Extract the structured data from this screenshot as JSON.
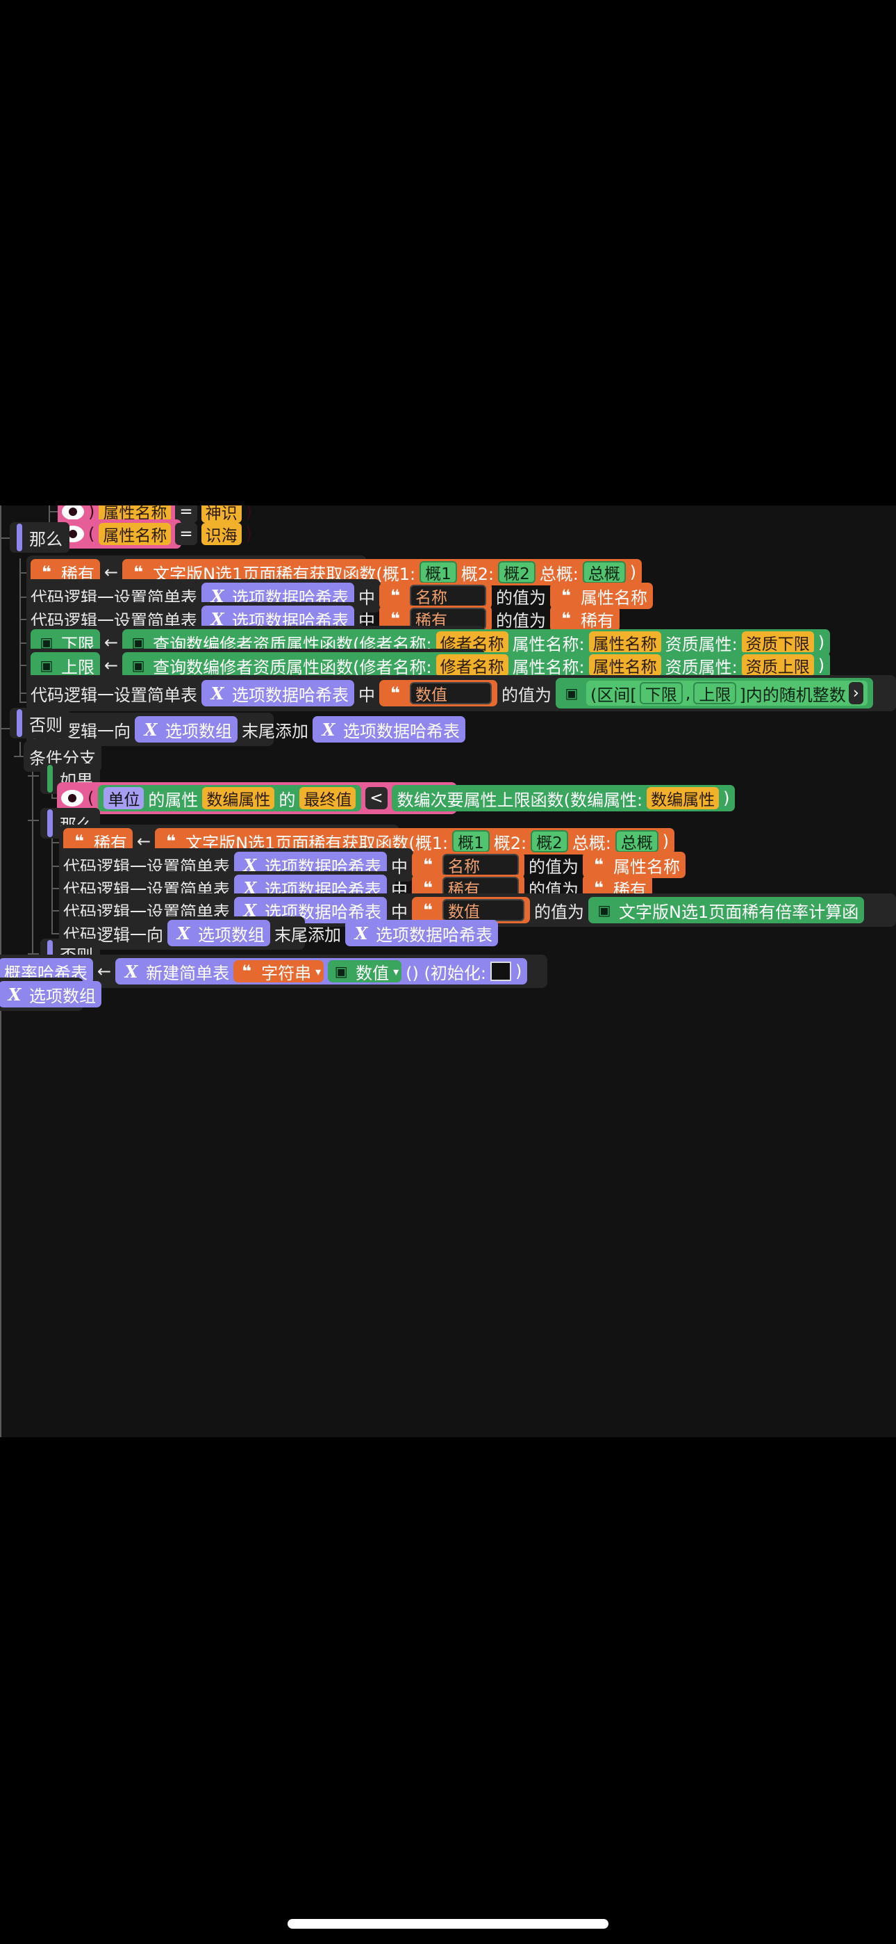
{
  "labels": {
    "then": "那么",
    "else": "否则",
    "branch": "条件分支",
    "if": "如果"
  },
  "cond_top": [
    {
      "field": "属性名称",
      "op": "=",
      "value": "神识"
    },
    {
      "field": "属性名称",
      "op": "=",
      "value": "识海"
    }
  ],
  "text": {
    "set_hash": "代码逻辑一设置简单表",
    "option_hash": "选项数据哈希表",
    "in": "中",
    "value_of": "的值为",
    "name": "名称",
    "rare": "稀有",
    "attr_name": "属性名称",
    "number": "数值",
    "append": "代码逻辑一向",
    "option_array": "选项数组",
    "tail_add": "末尾添加",
    "arrow": "←",
    "rare_fn": "文字版N选1页面稀有获取函数(概1:",
    "p1": "概1",
    "p2_label": "概2:",
    "p2": "概2",
    "total_label": "总概:",
    "total": "总概",
    "close": ")",
    "lower": "下限",
    "upper": "上限",
    "query_fn": "查询数编修者资质属性函数(修者名称:",
    "cultivator_name": "修者名称",
    "attr_name_label": "属性名称:",
    "quality_label": "资质属性:",
    "quality_lower": "资质下限",
    "quality_upper": "资质上限",
    "range_open": "(区间[",
    "comma": ",",
    "range_close": "]内的随机整数",
    "unit": "单位",
    "attr_of": "的属性",
    "num_attr": "数编属性",
    "of": "的",
    "final_value": "最终值",
    "lt": "<",
    "upper_fn": "数编次要属性上限函数(数编属性:",
    "ratio_fn": "文字版N选1页面稀有倍率计算函",
    "prob_hash": "概率哈希表",
    "new_table": "新建简单表",
    "string": "字符串",
    "init": "() (初始化:"
  }
}
